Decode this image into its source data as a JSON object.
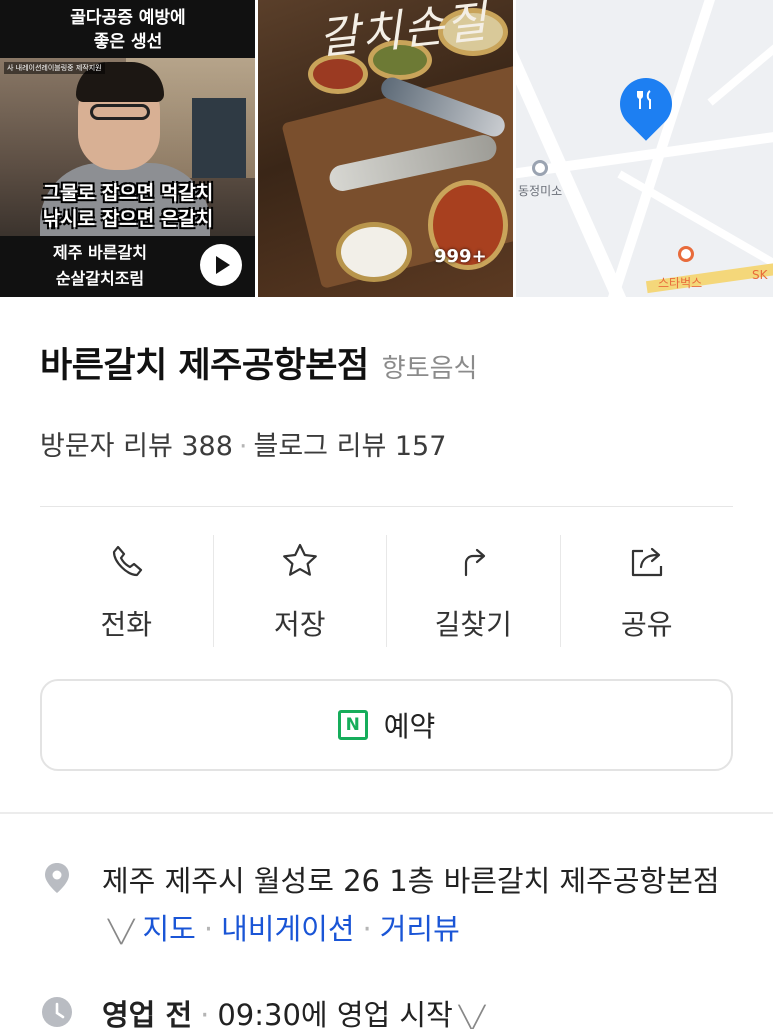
{
  "photos": {
    "video": {
      "caption_top_1": "골다공증 예방에",
      "caption_top_2": "좋은 생선",
      "tiny_tag": "사 내레이션레이블링중 제작지원",
      "overlay_line_1": "그물로 잡으면 먹갈치",
      "overlay_line_2": "낚시로 잡으면 은갈치",
      "caption_bottom_1": "제주 바른갈치",
      "caption_bottom_2": "순살갈치조림"
    },
    "food": {
      "title": "갈치손질",
      "count_badge": "999+"
    },
    "map": {
      "poi_1": "동정미소",
      "poi_2": "스타벅스",
      "poi_3": "SK"
    }
  },
  "place": {
    "name": "바른갈치 제주공항본점",
    "category": "향토음식"
  },
  "reviews": {
    "visitor_label": "방문자 리뷰 388",
    "blog_label": "블로그 리뷰 157"
  },
  "actions": [
    {
      "label": "전화",
      "icon": "phone-icon"
    },
    {
      "label": "저장",
      "icon": "star-icon"
    },
    {
      "label": "길찾기",
      "icon": "directions-icon"
    },
    {
      "label": "공유",
      "icon": "share-icon"
    }
  ],
  "reserve": {
    "label": "예약",
    "icon_letter": "N"
  },
  "address": {
    "text": "제주 제주시 월성로 26 1층 바른갈치 제주공항본점",
    "links": [
      "지도",
      "내비게이션",
      "거리뷰"
    ]
  },
  "hours": {
    "status": "영업 전",
    "detail": "09:30에 영업 시작"
  },
  "colors": {
    "link": "#1a55d6",
    "naver_green": "#16ad5b",
    "map_pin": "#1d7ff2"
  }
}
